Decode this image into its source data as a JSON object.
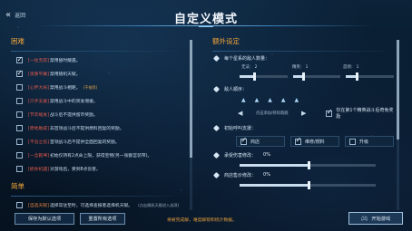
{
  "header": {
    "back_label": "返回",
    "title": "自定义模式"
  },
  "left": {
    "hard": {
      "title": "困难",
      "items": [
        {
          "tag": "[一往无前]",
          "text": "禁用替时耀遇。",
          "checked": true,
          "note": ""
        },
        {
          "tag": "[资质平庸]",
          "text": "禁用随机天赋。",
          "checked": true,
          "note": ""
        },
        {
          "tag": "[心怀大局]",
          "text": "禁用战斗相距。",
          "checked": false,
          "note": "(不推荐)"
        },
        {
          "tag": "[只手支援]",
          "text": "禁用战斗中的突发增援。",
          "checked": false,
          "note": ""
        },
        {
          "tag": "[节衣缩食]",
          "text": "战斗后不提供留币奖励。",
          "checked": false,
          "note": ""
        },
        {
          "tag": "[原地助威]",
          "text": "非首领战斗后不提供燃料回复的奖励。",
          "checked": false,
          "note": ""
        },
        {
          "tag": "[不治之伤]",
          "text": "首领战斗后不提供全面回复的奖励。",
          "checked": false,
          "note": ""
        },
        {
          "tag": "[一念乾坤]",
          "text": "初始仅持有2点命上限，获得宝物(另一张额宫装带)。",
          "checked": false,
          "note": ""
        },
        {
          "tag": "[扼杀机遇]",
          "text": "对游戏后，受到8点伤害。",
          "checked": false,
          "note": ""
        }
      ]
    },
    "easy": {
      "title": "简单",
      "items": [
        {
          "tag": "[自选天赋]",
          "text": "选择常驻至时，可选择查报者选择机天赋。",
          "checked": false,
          "note": "(点击随机天赋进入选项)"
        }
      ]
    }
  },
  "right": {
    "title": "额外设定",
    "enemy_count": {
      "label": "每个星系的敌人数量：",
      "sliders": [
        {
          "label": "无法：",
          "value": "2",
          "fill": 0.28
        },
        {
          "label": "精英：",
          "value": "1",
          "fill": 0.2
        },
        {
          "label": "首领：",
          "value": "1",
          "fill": 0.2
        }
      ]
    },
    "enemy_order": {
      "label": "敌人顺序：",
      "ship_glyphs": [
        "▲",
        "▲",
        "▲",
        "▲",
        "▲"
      ],
      "order_text": "点击添加/移除敌舰",
      "check_label": "仅在第1个精英战斗后奇免奖励",
      "checked": true
    },
    "initial_support": {
      "label": "初始呼叫支援：",
      "options": [
        {
          "label": "商店",
          "checked": true
        },
        {
          "label": "维修/燃料",
          "checked": true
        },
        {
          "label": "升级",
          "checked": false
        }
      ]
    },
    "damage_taken": {
      "label": "承受伤害修改：",
      "value": "0%",
      "fill": 0.5
    },
    "shop_price": {
      "label": "商店售价修改：",
      "value": "0%",
      "fill": 0.5
    }
  },
  "footer": {
    "save_default": "保存为默认选项",
    "reset_all": "重置所有选项",
    "warning": "将被完成解，难度解锁和统计数据。",
    "start_game": "开始游戏"
  }
}
